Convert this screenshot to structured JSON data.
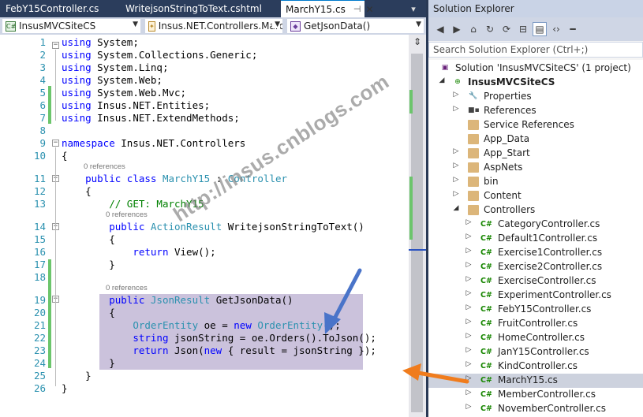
{
  "editor": {
    "tabs": [
      {
        "label": "FebY15Controller.cs"
      },
      {
        "label": "WritejsonStringToText.cshtml"
      },
      {
        "label": "MarchY15.cs",
        "active": true
      }
    ],
    "tabstrip_menu": "▾",
    "navbar": {
      "project": "InsusMVCSiteCS",
      "class": "Insus.NET.Controllers.Marc",
      "member": "GetJsonData()"
    },
    "code_lines": [
      {
        "n": "1",
        "text": "using System;"
      },
      {
        "n": "2",
        "text": "using System.Collections.Generic;"
      },
      {
        "n": "3",
        "text": "using System.Linq;"
      },
      {
        "n": "4",
        "text": "using System.Web;"
      },
      {
        "n": "5",
        "text": "using System.Web.Mvc;"
      },
      {
        "n": "6",
        "text": "using Insus.NET.Entities;"
      },
      {
        "n": "7",
        "text": "using Insus.NET.ExtendMethods;"
      },
      {
        "n": "8",
        "text": ""
      },
      {
        "n": "9",
        "text": "namespace Insus.NET.Controllers"
      },
      {
        "n": "10",
        "text": "{"
      },
      {
        "n": "11",
        "text": "    public class MarchY15 : Controller"
      },
      {
        "n": "12",
        "text": "    {"
      },
      {
        "n": "13",
        "text": "        // GET: MarchY15"
      },
      {
        "n": "14",
        "text": "        public ActionResult WritejsonStringToText()"
      },
      {
        "n": "15",
        "text": "        {"
      },
      {
        "n": "16",
        "text": "            return View();"
      },
      {
        "n": "17",
        "text": "        }"
      },
      {
        "n": "18",
        "text": ""
      },
      {
        "n": "19",
        "text": "        public JsonResult GetJsonData()"
      },
      {
        "n": "20",
        "text": "        {"
      },
      {
        "n": "21",
        "text": "            OrderEntity oe = new OrderEntity();"
      },
      {
        "n": "22",
        "text": "            string jsonString = oe.Orders().ToJson();"
      },
      {
        "n": "23",
        "text": "            return Json(new { result = jsonString });"
      },
      {
        "n": "24",
        "text": "        }"
      },
      {
        "n": "25",
        "text": "    }"
      },
      {
        "n": "26",
        "text": "}"
      }
    ],
    "refs_label": "0 references"
  },
  "solution_explorer": {
    "title": "Solution Explorer",
    "search_placeholder": "Search Solution Explorer (Ctrl+;)",
    "solution": "Solution 'InsusMVCSiteCS' (1 project)",
    "project": "InsusMVCSiteCS",
    "items": [
      {
        "label": "Properties"
      },
      {
        "label": "References"
      },
      {
        "label": "Service References"
      },
      {
        "label": "App_Data"
      },
      {
        "label": "App_Start"
      },
      {
        "label": "AspNets"
      },
      {
        "label": "bin"
      },
      {
        "label": "Content"
      },
      {
        "label": "Controllers"
      }
    ],
    "controllers": [
      {
        "label": "CategoryController.cs"
      },
      {
        "label": "Default1Controller.cs"
      },
      {
        "label": "Exercise1Controller.cs"
      },
      {
        "label": "Exercise2Controller.cs"
      },
      {
        "label": "ExerciseController.cs"
      },
      {
        "label": "ExperimentController.cs"
      },
      {
        "label": "FebY15Controller.cs"
      },
      {
        "label": "FruitController.cs"
      },
      {
        "label": "HomeController.cs"
      },
      {
        "label": "JanY15Controller.cs"
      },
      {
        "label": "KindController.cs"
      },
      {
        "label": "MarchY15.cs",
        "selected": true
      },
      {
        "label": "MemberController.cs"
      },
      {
        "label": "NovemberController.cs"
      }
    ]
  },
  "watermark": "http://insus.cnblogs.com",
  "colors": {
    "keyword": "#0000ff",
    "type": "#2b91af",
    "comment": "#008000",
    "selection": "#cbc2dc",
    "annotation_arrow_orange": "#f07c1d",
    "annotation_arrow_blue": "#4a74c9"
  }
}
